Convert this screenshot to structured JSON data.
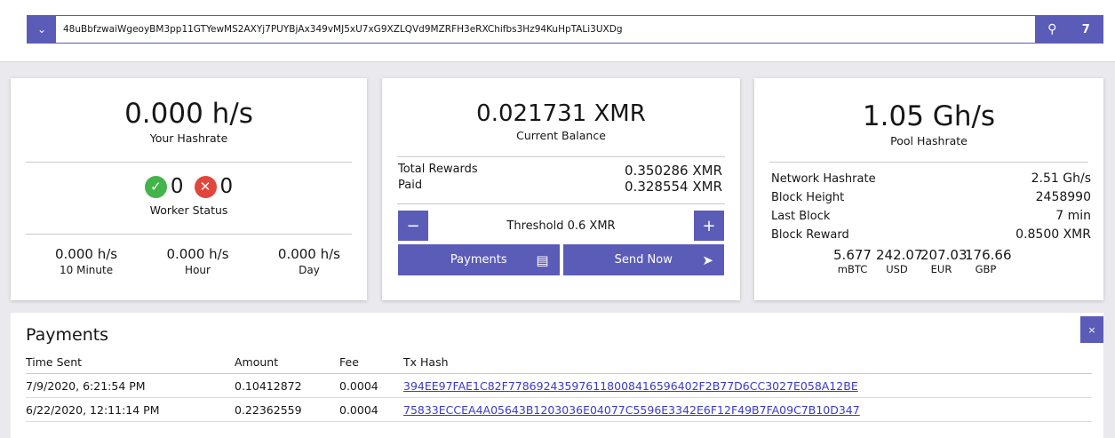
{
  "address": {
    "value": "48uBbfzwaiWgeoyBM3pp11GTYewMS2AXYj7PUYBjAx349vMJ5xU7xG9XZLQVd9MZRFH3eRXChifbs3Hz94KuHpTALi3UXDg",
    "count": "7"
  },
  "your_hashrate": {
    "value": "0.000 h/s",
    "label": "Your Hashrate",
    "worker_ok": "0",
    "worker_bad": "0",
    "worker_label": "Worker Status",
    "rates": [
      {
        "value": "0.000 h/s",
        "label": "10 Minute"
      },
      {
        "value": "0.000 h/s",
        "label": "Hour"
      },
      {
        "value": "0.000 h/s",
        "label": "Day"
      }
    ]
  },
  "balance": {
    "value": "0.021731 XMR",
    "label": "Current Balance",
    "total_rewards_label": "Total Rewards",
    "total_rewards": "0.350286 XMR",
    "paid_label": "Paid",
    "paid": "0.328554 XMR",
    "threshold": "Threshold 0.6 XMR",
    "minus": "−",
    "plus": "+",
    "payments_btn": "Payments",
    "send_btn": "Send Now"
  },
  "pool": {
    "value": "1.05 Gh/s",
    "label": "Pool Hashrate",
    "stats": [
      {
        "label": "Network Hashrate",
        "value": "2.51 Gh/s"
      },
      {
        "label": "Block Height",
        "value": "2458990"
      },
      {
        "label": "Last Block",
        "value": "7 min"
      },
      {
        "label": "Block Reward",
        "value": "0.8500 XMR"
      }
    ],
    "fiat": [
      {
        "value": "5.677",
        "label": "mBTC"
      },
      {
        "value": "242.07",
        "label": "USD"
      },
      {
        "value": "207.03",
        "label": "EUR"
      },
      {
        "value": "176.66",
        "label": "GBP"
      }
    ]
  },
  "payments": {
    "title": "Payments",
    "close": "×",
    "headers": [
      "Time Sent",
      "Amount",
      "Fee",
      "Tx Hash"
    ],
    "rows": [
      {
        "time": "7/9/2020, 6:21:54 PM",
        "amount": "0.10412872",
        "fee": "0.0004",
        "hash": "394EE97FAE1C82F778692435976118008416596402F2B77D6CC3027E058A12BE"
      },
      {
        "time": "6/22/2020, 12:11:14 PM",
        "amount": "0.22362559",
        "fee": "0.0004",
        "hash": "75833ECCEA4A05643B1203036E04077C5596E3342E6F12F49B7FA09C7B10D347"
      }
    ]
  },
  "colors": {
    "accent": "#5b5cb8",
    "ok": "#42b44a",
    "bad": "#e2453c",
    "link": "#3a3acb"
  }
}
